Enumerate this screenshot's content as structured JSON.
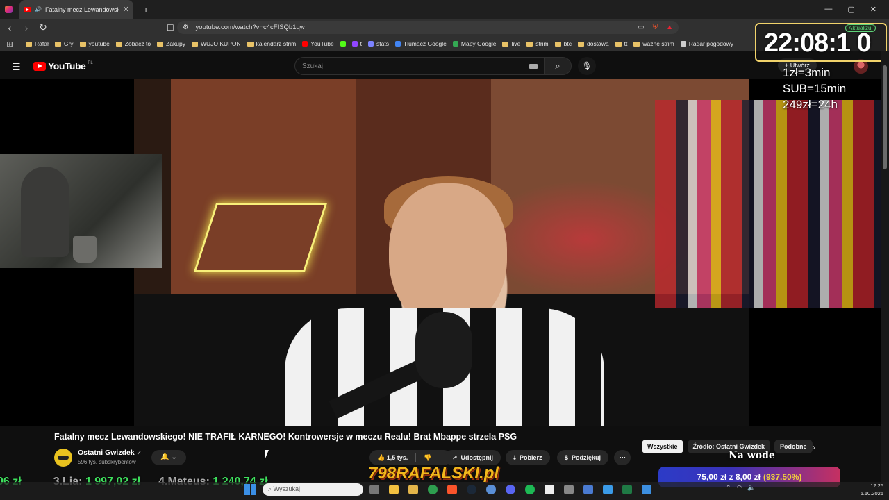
{
  "browser": {
    "tab_title": "Fatalny mecz Lewandowskieg",
    "url": "youtube.com/watch?v=c4cFISQb1qw",
    "new_tab_label": "+",
    "window_controls": [
      "—",
      "▢",
      "✕"
    ]
  },
  "bookmarks": [
    {
      "label": "Rafał",
      "kind": "folder"
    },
    {
      "label": "Gry",
      "kind": "folder"
    },
    {
      "label": "youtube",
      "kind": "folder"
    },
    {
      "label": "Zobacz to",
      "kind": "folder"
    },
    {
      "label": "Zakupy",
      "kind": "folder"
    },
    {
      "label": "WUJO KUPON",
      "kind": "folder"
    },
    {
      "label": "kalendarz strim",
      "kind": "folder"
    },
    {
      "label": "YouTube",
      "kind": "site",
      "color": "#ff0000"
    },
    {
      "label": "",
      "kind": "site",
      "color": "#53fc18"
    },
    {
      "label": "t",
      "kind": "site",
      "color": "#9146ff"
    },
    {
      "label": "stats",
      "kind": "site",
      "color": "#7c83ff"
    },
    {
      "label": "Tłumacz Google",
      "kind": "site",
      "color": "#4285f4"
    },
    {
      "label": "Mapy Google",
      "kind": "site",
      "color": "#34a853"
    },
    {
      "label": "live",
      "kind": "folder"
    },
    {
      "label": "strim",
      "kind": "folder"
    },
    {
      "label": "btc",
      "kind": "folder"
    },
    {
      "label": "dostawa",
      "kind": "folder"
    },
    {
      "label": "tt",
      "kind": "folder"
    },
    {
      "label": "ważne strim",
      "kind": "folder"
    },
    {
      "label": "Radar pogodowy",
      "kind": "site",
      "color": "#cccccc"
    }
  ],
  "youtube": {
    "logo_text": "YouTube",
    "region": "PL",
    "search_placeholder": "Szukaj",
    "create_label": "Utwórz"
  },
  "overlay": {
    "timer": "22:08:1 0",
    "update_label": "Aktualizuj",
    "price_lines": [
      "1zł=3min",
      "SUB=15min",
      "249zł=24h"
    ],
    "na_wode": "Na wode",
    "donation": {
      "main": "75,00 zł z 8,00 zł",
      "percent": "(937.50%)"
    },
    "brand": "798RAFALSKI.pl",
    "leaderboard": [
      {
        "rank": "",
        "amount": "06 zł"
      },
      {
        "rank": "3.Lia:",
        "amount": "1 997,02 zł"
      },
      {
        "rank": "4.Mateus:",
        "amount": "1 240,74 zł"
      }
    ]
  },
  "video": {
    "title": "Fatalny mecz Lewandowskiego! NIE TRAFIŁ KARNEGO! Kontrowersje w meczu Realu! Brat Mbappe strzela PSG",
    "channel": "Ostatni Gwizdek",
    "subscribers": "596 tys. subskrybentów",
    "likes": "1,5 tys.",
    "share_label": "Udostępnij",
    "download_label": "Pobierz",
    "thanks_label": "Podziękuj"
  },
  "chips": [
    {
      "label": "Wszystkie",
      "active": true
    },
    {
      "label": "Źródło: Ostatni Gwizdek",
      "active": false
    },
    {
      "label": "Podobne",
      "active": false
    }
  ],
  "taskbar": {
    "search_placeholder": "Wyszukaj",
    "time": "12:25",
    "date": "6.10.2025"
  }
}
